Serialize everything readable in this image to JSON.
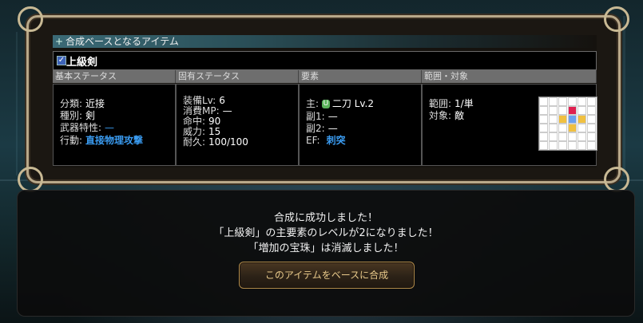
{
  "section_title": "合成ベースとなるアイテム",
  "item": {
    "name": "上級剣"
  },
  "columns": {
    "basic": "基本ステータス",
    "unique": "固有ステータス",
    "element": "要素",
    "range": "範囲・対象"
  },
  "basic_stats": [
    {
      "label": "分類:",
      "value": "近接"
    },
    {
      "label": "種別:",
      "value": "剣"
    },
    {
      "label": "武器特性:",
      "value": "—"
    },
    {
      "label": "行動:",
      "value": "直接物理攻撃"
    }
  ],
  "unique_stats": [
    {
      "label": "装備Lv:",
      "value": "6"
    },
    {
      "label": "消費MP:",
      "value": "—"
    },
    {
      "label": "命中:",
      "value": "90"
    },
    {
      "label": "威力:",
      "value": "15"
    },
    {
      "label": "耐久:",
      "value": "100/100"
    }
  ],
  "elements": [
    {
      "label": "主:",
      "badge": "U",
      "value": "二刀 Lv.2"
    },
    {
      "label": "副1:",
      "value": "—"
    },
    {
      "label": "副2:",
      "value": "—"
    },
    {
      "label": "EF:",
      "value": "刺突"
    }
  ],
  "range_info": [
    {
      "label": "範囲:",
      "value": "1/単"
    },
    {
      "label": "対象:",
      "value": "敵"
    }
  ],
  "messages": {
    "line1": "合成に成功しました！",
    "line2": "「上級剣」の主要素のレベルが2になりました！",
    "line3": "「増加の宝珠」は消滅しました！"
  },
  "action_button": "このアイテムをベースに合成",
  "colors": {
    "accent_blue": "#3a9bf0",
    "header_teal": "#3b6a76",
    "button_gold": "#e8c98a"
  }
}
